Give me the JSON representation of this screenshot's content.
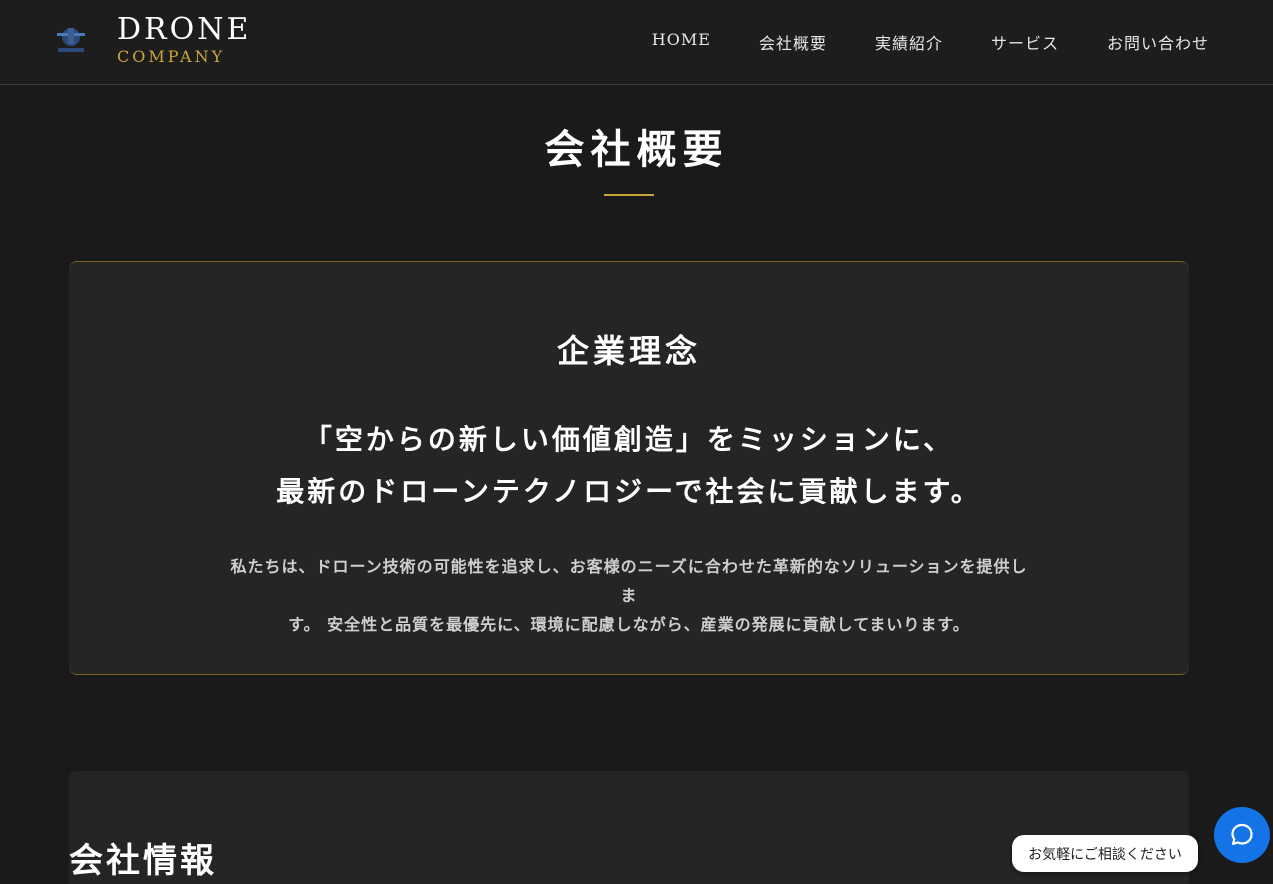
{
  "header": {
    "brand_name": "DRONE",
    "brand_sub": "COMPANY",
    "nav": [
      "HOME",
      "会社概要",
      "実績紹介",
      "サービス",
      "お問い合わせ"
    ]
  },
  "page": {
    "title": "会社概要"
  },
  "philosophy": {
    "heading": "企業理念",
    "mission_line1": "「空からの新しい価値創造」をミッションに、",
    "mission_line2": "最新のドローンテクノロジーで社会に貢献します。",
    "body_line1": "私たちは、ドローン技術の可能性を追求し、お客様のニーズに合わせた革新的なソリューションを提供しま",
    "body_line2": "す。 安全性と品質を最優先に、環境に配慮しながら、産業の発展に貢献してまいります。"
  },
  "company_info": {
    "heading": "会社情報"
  },
  "chat": {
    "prompt": "お気軽にご相談ください",
    "icon": "chat-icon"
  },
  "colors": {
    "accent": "#c9a63a",
    "background": "#1a1a1a",
    "card": "#252525",
    "chat_button": "#1473e6"
  }
}
